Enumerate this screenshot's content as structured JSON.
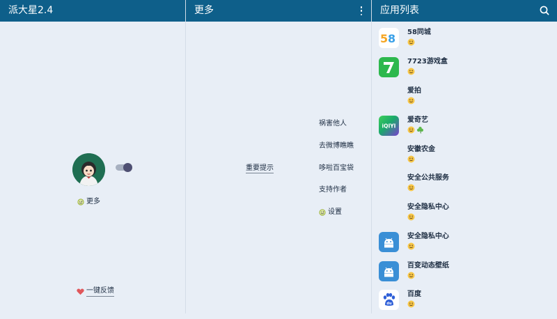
{
  "colors": {
    "appbar": "#0e5f8a",
    "background": "#e8eef6",
    "text": "#1f2f44"
  },
  "left_pane": {
    "title": "派大星2.4",
    "more_label": "更多",
    "feedback_label": "一键反馈"
  },
  "middle_pane": {
    "title": "更多",
    "notice_label": "重要提示",
    "menu": [
      "祸害他人",
      "去微博瞧瞧",
      "哆啦百宝袋",
      "支持作者"
    ],
    "settings_label": "设置"
  },
  "right_pane": {
    "title": "应用列表",
    "apps": [
      {
        "name": "58同城",
        "icon": "58-logo-icon",
        "badges": [
          "smiley"
        ]
      },
      {
        "name": "7723游戏盒",
        "icon": "7723-logo-icon",
        "badges": [
          "smiley"
        ]
      },
      {
        "name": "爱拍",
        "icon": "none",
        "badges": [
          "smiley"
        ]
      },
      {
        "name": "爱奇艺",
        "icon": "iqiyi-logo-icon",
        "badges": [
          "smiley",
          "clover"
        ]
      },
      {
        "name": "安徽农金",
        "icon": "none",
        "badges": [
          "smiley"
        ]
      },
      {
        "name": "安全公共服务",
        "icon": "none",
        "badges": [
          "smiley"
        ]
      },
      {
        "name": "安全隐私中心",
        "icon": "none",
        "badges": [
          "smiley"
        ]
      },
      {
        "name": "安全隐私中心",
        "icon": "android-icon",
        "badges": [
          "smiley"
        ]
      },
      {
        "name": "百变动态壁纸",
        "icon": "android-icon",
        "badges": [
          "smiley"
        ]
      },
      {
        "name": "百度",
        "icon": "baidu-paw-icon",
        "badges": [
          "smiley"
        ]
      }
    ]
  }
}
